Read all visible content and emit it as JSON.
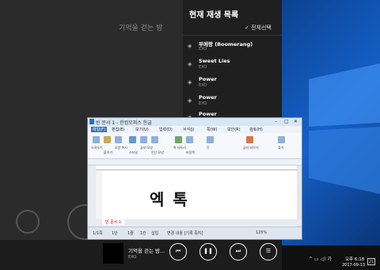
{
  "music_app": {
    "bg_title": "기억을 걷는 밤",
    "bg_sub": "EXO"
  },
  "playlist": {
    "title": "현재 재생 목록",
    "select_all": "전체선택",
    "items": [
      {
        "title": "부메랑 (Boomerang)",
        "artist": "EXO"
      },
      {
        "title": "Sweet Lies",
        "artist": "EXO"
      },
      {
        "title": "Power",
        "artist": "EXO"
      },
      {
        "title": "Power",
        "artist": "EXO"
      },
      {
        "title": "Power",
        "artist": ""
      }
    ]
  },
  "hwp": {
    "title": "빈 문서 1 - 한컴오피스 한글",
    "menus": [
      "파일(F)",
      "편집(E)",
      "보기(U)",
      "입력(D)",
      "서식(J)",
      "쪽(W)",
      "보안(R)",
      "검토(H)"
    ],
    "ribbon_labels": [
      "오려두기",
      "붙이기",
      "모양 복사",
      "스타일",
      "글자 모양",
      "문단 모양",
      "쪽 테두리",
      "바탕쪽",
      "단",
      "글자 바꾸기",
      "찾기"
    ],
    "doc_text": "엑 톡",
    "doc_tab": "빈 문서 1",
    "status": {
      "page": "1/1쪽",
      "section": "1단",
      "line": "1줄",
      "col": "1칸",
      "insert": "삽입",
      "track": "변경 내용 [기록 중지]",
      "zoom": "125%"
    }
  },
  "now_playing": {
    "title": "기억을 걷는 밤...",
    "artist": "EXO"
  },
  "tray": {
    "lang": "가",
    "time": "오후 6:18",
    "date": "2017-09-13",
    "notif_count": "21"
  }
}
